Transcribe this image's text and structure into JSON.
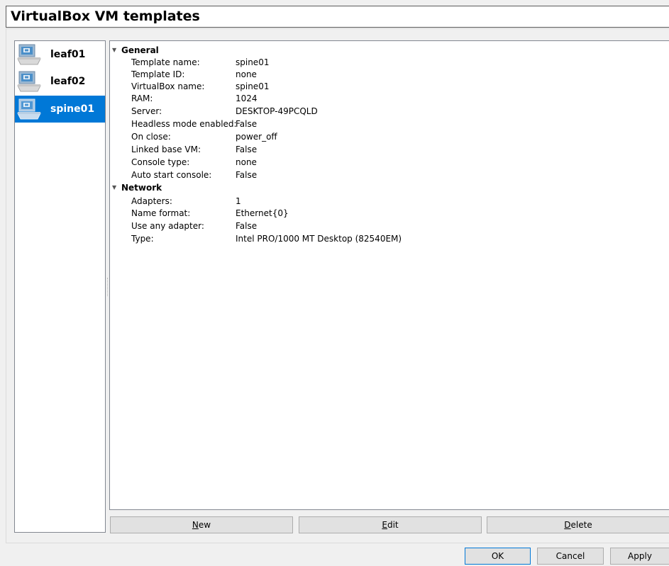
{
  "window": {
    "title": "VirtualBox VM templates"
  },
  "templates": [
    {
      "label": "leaf01",
      "icon": "vm-monitor-icon",
      "selected": false
    },
    {
      "label": "leaf02",
      "icon": "vm-monitor-icon",
      "selected": false
    },
    {
      "label": "spine01",
      "icon": "vm-monitor-icon",
      "selected": true
    }
  ],
  "info": {
    "general": {
      "label": "General",
      "rows": [
        {
          "key": "Template name:",
          "value": "spine01"
        },
        {
          "key": "Template ID:",
          "value": "none"
        },
        {
          "key": "VirtualBox name:",
          "value": "spine01"
        },
        {
          "key": "RAM:",
          "value": "1024"
        },
        {
          "key": "Server:",
          "value": "DESKTOP-49PCQLD"
        },
        {
          "key": "Headless mode enabled:",
          "value": "False"
        },
        {
          "key": "On close:",
          "value": "power_off"
        },
        {
          "key": "Linked base VM:",
          "value": "False"
        },
        {
          "key": "Console type:",
          "value": "none"
        },
        {
          "key": "Auto start console:",
          "value": "False"
        }
      ]
    },
    "network": {
      "label": "Network",
      "rows": [
        {
          "key": "Adapters:",
          "value": "1"
        },
        {
          "key": "Name format:",
          "value": "Ethernet{0}"
        },
        {
          "key": "Use any adapter:",
          "value": "False"
        },
        {
          "key": "Type:",
          "value": "Intel PRO/1000 MT Desktop (82540EM)"
        }
      ]
    }
  },
  "actions": {
    "new": {
      "mnemonic": "N",
      "rest": "ew"
    },
    "edit": {
      "mnemonic": "E",
      "rest": "dit"
    },
    "delete": {
      "mnemonic": "D",
      "rest": "elete"
    }
  },
  "dialog": {
    "ok": "OK",
    "cancel": "Cancel",
    "apply": "Apply"
  },
  "colors": {
    "selection": "#0078d7",
    "default_button_border": "#0078d7"
  }
}
